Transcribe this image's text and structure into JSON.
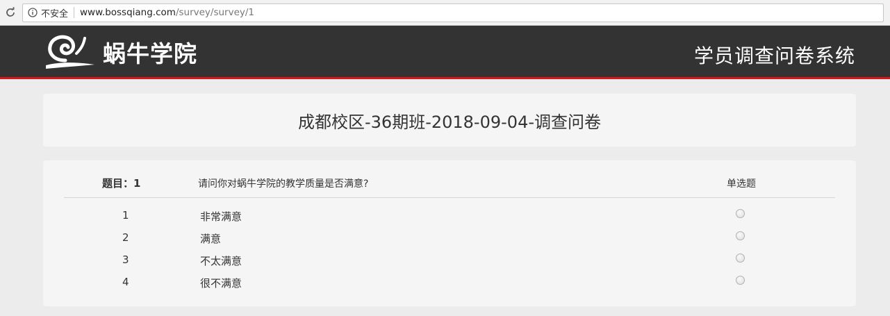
{
  "browser": {
    "security_label": "不安全",
    "url_host": "www.bossqiang.com",
    "url_path": "/survey/survey/1",
    "icons": [
      "reload-icon",
      "info-icon"
    ]
  },
  "header": {
    "logo_text": "蜗牛学院",
    "system_title": "学员调查问卷系统",
    "background_color": "#333333",
    "accent_color": "#d9161b"
  },
  "survey": {
    "title": "成都校区-36期班-2018-09-04-调查问卷"
  },
  "question": {
    "number_label": "题目：1",
    "text": "请问你对蜗牛学院的教学质量是否满意?",
    "type": "单选题",
    "options": [
      {
        "index": "1",
        "label": "非常满意"
      },
      {
        "index": "2",
        "label": "满意"
      },
      {
        "index": "3",
        "label": "不太满意"
      },
      {
        "index": "4",
        "label": "很不满意"
      }
    ]
  }
}
